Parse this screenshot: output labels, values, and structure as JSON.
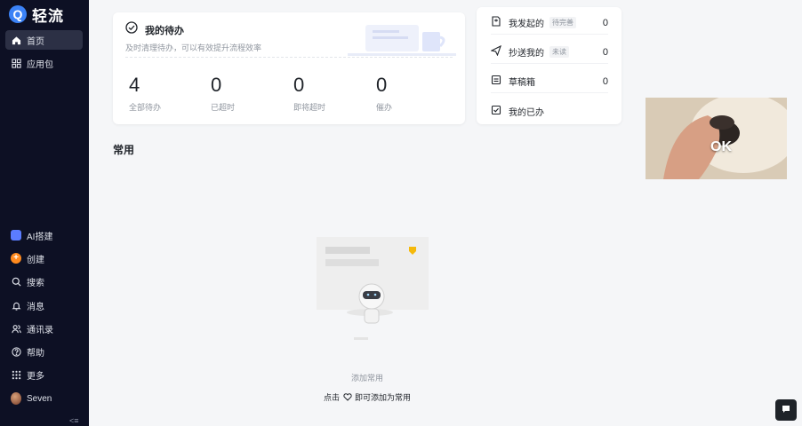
{
  "app": {
    "name": "轻流",
    "logo_letter": "Q"
  },
  "sidebar": {
    "top_items": [
      {
        "label": "首页",
        "icon": "home-icon",
        "active": true
      },
      {
        "label": "应用包",
        "icon": "grid-icon",
        "active": false
      }
    ],
    "bottom_items": [
      {
        "label": "AI搭建",
        "icon": "ai-icon"
      },
      {
        "label": "创建",
        "icon": "plus-icon"
      },
      {
        "label": "搜索",
        "icon": "search-icon"
      },
      {
        "label": "消息",
        "icon": "bell-icon"
      },
      {
        "label": "通讯录",
        "icon": "contacts-icon"
      },
      {
        "label": "帮助",
        "icon": "help-icon"
      },
      {
        "label": "更多",
        "icon": "more-grid-icon"
      },
      {
        "label": "Seven",
        "icon": "avatar"
      }
    ],
    "collapse_glyph": "<≡"
  },
  "todo": {
    "title": "我的待办",
    "subtitle": "及时清理待办，可以有效提升流程效率",
    "stats": [
      {
        "value": "4",
        "label": "全部待办"
      },
      {
        "value": "0",
        "label": "已超时"
      },
      {
        "value": "0",
        "label": "即将超时"
      },
      {
        "value": "0",
        "label": "催办"
      }
    ]
  },
  "side_panel": {
    "rows": [
      {
        "label": "我发起的",
        "tag": "待完善",
        "count": "0",
        "icon": "doc-add-icon"
      },
      {
        "label": "抄送我的",
        "tag": "未读",
        "count": "0",
        "icon": "send-icon"
      },
      {
        "label": "草稿箱",
        "tag": "",
        "count": "0",
        "icon": "draft-icon"
      },
      {
        "label": "我的已办",
        "tag": "",
        "count": "",
        "icon": "check-box-icon"
      }
    ]
  },
  "common": {
    "title": "常用",
    "empty_title": "添加常用",
    "hint_prefix": "点击",
    "hint_suffix": "即可添加为常用"
  },
  "video_overlay": {
    "text": "OK"
  }
}
